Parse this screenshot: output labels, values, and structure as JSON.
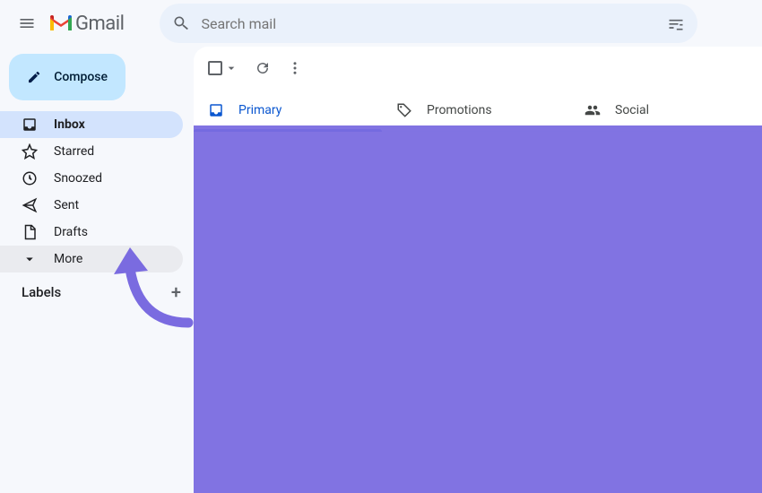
{
  "header": {
    "product_name": "Gmail",
    "search_placeholder": "Search mail"
  },
  "compose_label": "Compose",
  "sidebar": {
    "items": [
      {
        "label": "Inbox",
        "active": true
      },
      {
        "label": "Starred"
      },
      {
        "label": "Snoozed"
      },
      {
        "label": "Sent"
      },
      {
        "label": "Drafts"
      },
      {
        "label": "More"
      }
    ]
  },
  "labels_heading": "Labels",
  "tabs": [
    {
      "label": "Primary",
      "active": true
    },
    {
      "label": "Promotions"
    },
    {
      "label": "Social"
    }
  ],
  "annotation": {
    "overlay_color": "#7a6be0",
    "arrow_color": "#7a6be0"
  }
}
